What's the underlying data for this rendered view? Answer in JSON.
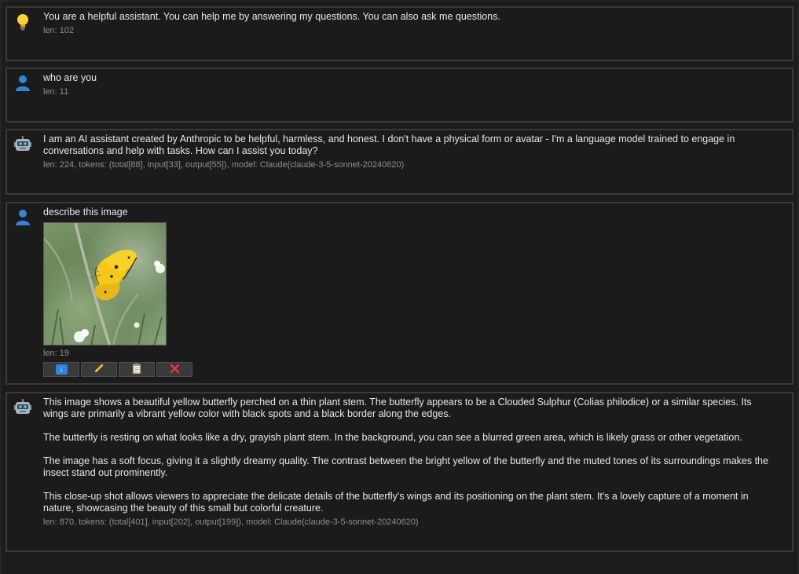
{
  "messages": [
    {
      "role_icon": "lightbulb-icon",
      "text": "You are a helpful assistant. You can help me by answering my questions. You can also ask me questions.",
      "meta": "len: 102"
    },
    {
      "role_icon": "user-icon",
      "text": "who are you",
      "meta": "len: 11"
    },
    {
      "role_icon": "robot-icon",
      "text": "I am an AI assistant created by Anthropic to be helpful, harmless, and honest. I don't have a physical form or avatar - I'm a language model trained to engage in conversations and help with tasks. How can I assist you today?",
      "meta": "len: 224, tokens: (total[88], input[33], output[55]), model: Claude(claude-3-5-sonnet-20240620)"
    },
    {
      "role_icon": "user-icon",
      "text": "describe this image",
      "image_alt": "yellow butterfly on plant stem",
      "meta": "len: 19",
      "actions": [
        {
          "icon": "download-icon",
          "glyph": "⬇"
        },
        {
          "icon": "edit-icon",
          "glyph": "✏"
        },
        {
          "icon": "copy-icon",
          "glyph": "📋"
        },
        {
          "icon": "delete-icon",
          "glyph": "✕"
        }
      ]
    },
    {
      "role_icon": "robot-icon",
      "paragraphs": [
        "This image shows a beautiful yellow butterfly perched on a thin plant stem. The butterfly appears to be a Clouded Sulphur (Colias philodice) or a similar species. Its wings are primarily a vibrant yellow color with black spots and a black border along the edges.",
        "The butterfly is resting on what looks like a dry, grayish plant stem. In the background, you can see a blurred green area, which is likely grass or other vegetation.",
        "The image has a soft focus, giving it a slightly dreamy quality. The contrast between the bright yellow of the butterfly and the muted tones of its surroundings makes the insect stand out prominently.",
        "This close-up shot allows viewers to appreciate the delicate details of the butterfly's wings and its positioning on the plant stem. It's a lovely capture of a moment in nature, showcasing the beauty of this small but colorful creature."
      ],
      "meta": "len: 870, tokens: (total[401], input[202], output[199]), model: Claude(claude-3-5-sonnet-20240620)"
    }
  ],
  "colors": {
    "background": "#1c1c1c",
    "border": "#3a3a3a",
    "text": "#e8e8e8",
    "meta": "#8e8e8e",
    "user_icon": "#2f86d8",
    "bulb_icon": "#ffd23a"
  }
}
